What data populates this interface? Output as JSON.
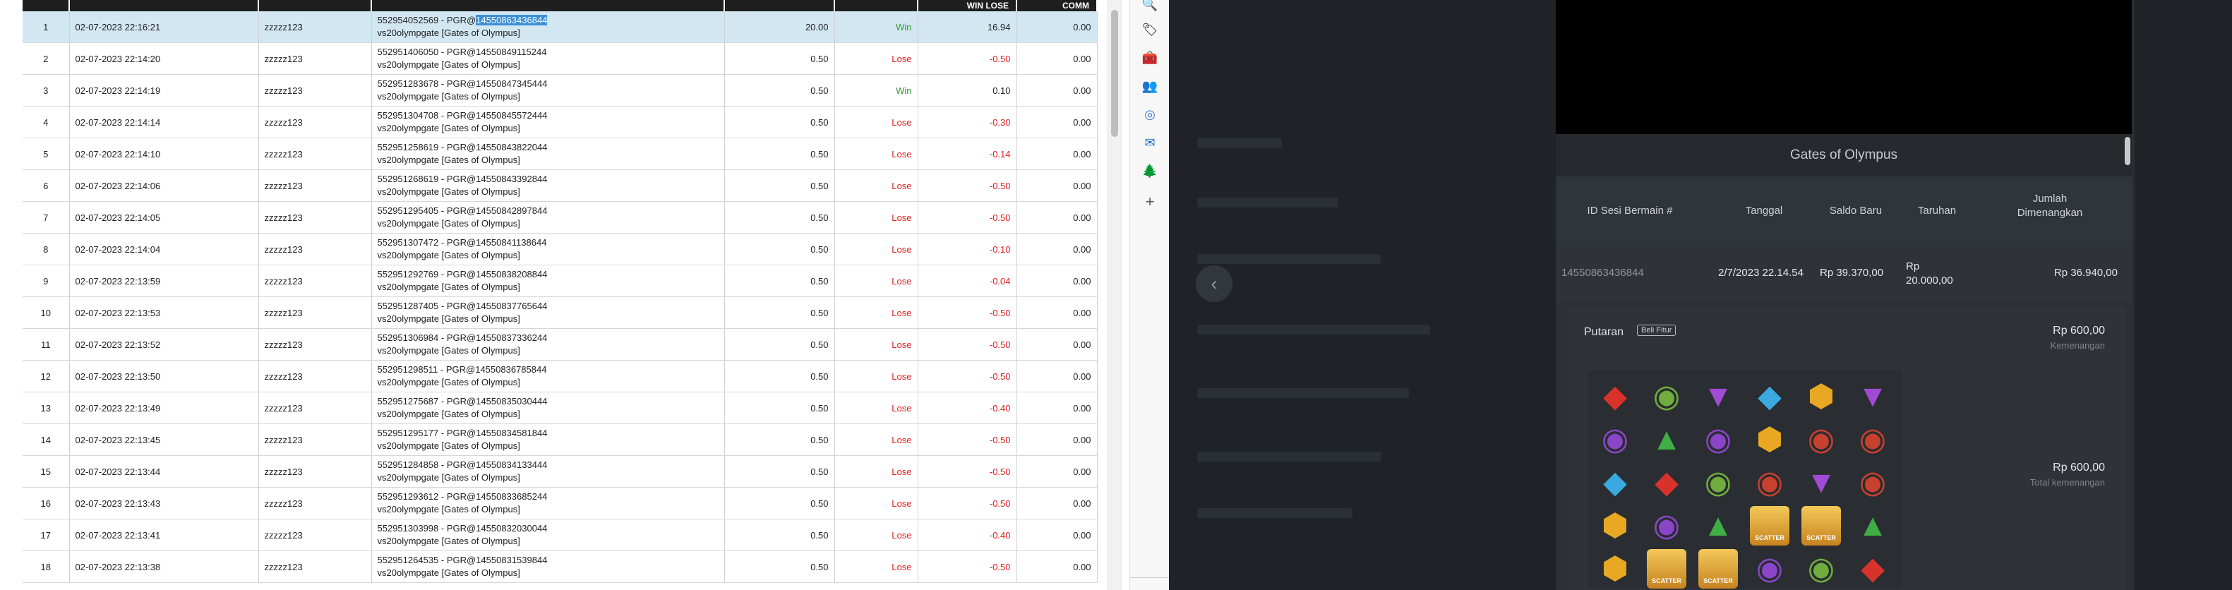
{
  "table": {
    "headers": [
      "",
      "",
      "",
      "",
      "",
      "",
      "WIN LOSE",
      "COMM"
    ],
    "rows": [
      {
        "no": "1",
        "date": "02-07-2023 22:16:21",
        "user": "zzzzz123",
        "round_prefix": "552954052569 - PGR@",
        "round_hl": "14550863436844",
        "game": "vs20olympgate [Gates of Olympus]",
        "bet": "20.00",
        "result": "Win",
        "winlose": "16.94",
        "comm": "0.00"
      },
      {
        "no": "2",
        "date": "02-07-2023 22:14:20",
        "user": "zzzzz123",
        "round_prefix": "552951406050 - PGR@14550849115244",
        "round_hl": "",
        "game": "vs20olympgate [Gates of Olympus]",
        "bet": "0.50",
        "result": "Lose",
        "winlose": "-0.50",
        "comm": "0.00"
      },
      {
        "no": "3",
        "date": "02-07-2023 22:14:19",
        "user": "zzzzz123",
        "round_prefix": "552951283678 - PGR@14550847345444",
        "round_hl": "",
        "game": "vs20olympgate [Gates of Olympus]",
        "bet": "0.50",
        "result": "Win",
        "winlose": "0.10",
        "comm": "0.00"
      },
      {
        "no": "4",
        "date": "02-07-2023 22:14:14",
        "user": "zzzzz123",
        "round_prefix": "552951304708 - PGR@14550845572444",
        "round_hl": "",
        "game": "vs20olympgate [Gates of Olympus]",
        "bet": "0.50",
        "result": "Lose",
        "winlose": "-0.30",
        "comm": "0.00"
      },
      {
        "no": "5",
        "date": "02-07-2023 22:14:10",
        "user": "zzzzz123",
        "round_prefix": "552951258619 - PGR@14550843822044",
        "round_hl": "",
        "game": "vs20olympgate [Gates of Olympus]",
        "bet": "0.50",
        "result": "Lose",
        "winlose": "-0.14",
        "comm": "0.00"
      },
      {
        "no": "6",
        "date": "02-07-2023 22:14:06",
        "user": "zzzzz123",
        "round_prefix": "552951268619 - PGR@14550843392844",
        "round_hl": "",
        "game": "vs20olympgate [Gates of Olympus]",
        "bet": "0.50",
        "result": "Lose",
        "winlose": "-0.50",
        "comm": "0.00"
      },
      {
        "no": "7",
        "date": "02-07-2023 22:14:05",
        "user": "zzzzz123",
        "round_prefix": "552951295405 - PGR@14550842897844",
        "round_hl": "",
        "game": "vs20olympgate [Gates of Olympus]",
        "bet": "0.50",
        "result": "Lose",
        "winlose": "-0.50",
        "comm": "0.00"
      },
      {
        "no": "8",
        "date": "02-07-2023 22:14:04",
        "user": "zzzzz123",
        "round_prefix": "552951307472 - PGR@14550841138644",
        "round_hl": "",
        "game": "vs20olympgate [Gates of Olympus]",
        "bet": "0.50",
        "result": "Lose",
        "winlose": "-0.10",
        "comm": "0.00"
      },
      {
        "no": "9",
        "date": "02-07-2023 22:13:59",
        "user": "zzzzz123",
        "round_prefix": "552951292769 - PGR@14550838208844",
        "round_hl": "",
        "game": "vs20olympgate [Gates of Olympus]",
        "bet": "0.50",
        "result": "Lose",
        "winlose": "-0.04",
        "comm": "0.00"
      },
      {
        "no": "10",
        "date": "02-07-2023 22:13:53",
        "user": "zzzzz123",
        "round_prefix": "552951287405 - PGR@14550837765644",
        "round_hl": "",
        "game": "vs20olympgate [Gates of Olympus]",
        "bet": "0.50",
        "result": "Lose",
        "winlose": "-0.50",
        "comm": "0.00"
      },
      {
        "no": "11",
        "date": "02-07-2023 22:13:52",
        "user": "zzzzz123",
        "round_prefix": "552951306984 - PGR@14550837336244",
        "round_hl": "",
        "game": "vs20olympgate [Gates of Olympus]",
        "bet": "0.50",
        "result": "Lose",
        "winlose": "-0.50",
        "comm": "0.00"
      },
      {
        "no": "12",
        "date": "02-07-2023 22:13:50",
        "user": "zzzzz123",
        "round_prefix": "552951298511 - PGR@14550836785844",
        "round_hl": "",
        "game": "vs20olympgate [Gates of Olympus]",
        "bet": "0.50",
        "result": "Lose",
        "winlose": "-0.50",
        "comm": "0.00"
      },
      {
        "no": "13",
        "date": "02-07-2023 22:13:49",
        "user": "zzzzz123",
        "round_prefix": "552951275687 - PGR@14550835030444",
        "round_hl": "",
        "game": "vs20olympgate [Gates of Olympus]",
        "bet": "0.50",
        "result": "Lose",
        "winlose": "-0.40",
        "comm": "0.00"
      },
      {
        "no": "14",
        "date": "02-07-2023 22:13:45",
        "user": "zzzzz123",
        "round_prefix": "552951295177 - PGR@14550834581844",
        "round_hl": "",
        "game": "vs20olympgate [Gates of Olympus]",
        "bet": "0.50",
        "result": "Lose",
        "winlose": "-0.50",
        "comm": "0.00"
      },
      {
        "no": "15",
        "date": "02-07-2023 22:13:44",
        "user": "zzzzz123",
        "round_prefix": "552951284858 - PGR@14550834133444",
        "round_hl": "",
        "game": "vs20olympgate [Gates of Olympus]",
        "bet": "0.50",
        "result": "Lose",
        "winlose": "-0.50",
        "comm": "0.00"
      },
      {
        "no": "16",
        "date": "02-07-2023 22:13:43",
        "user": "zzzzz123",
        "round_prefix": "552951293612 - PGR@14550833685244",
        "round_hl": "",
        "game": "vs20olympgate [Gates of Olympus]",
        "bet": "0.50",
        "result": "Lose",
        "winlose": "-0.50",
        "comm": "0.00"
      },
      {
        "no": "17",
        "date": "02-07-2023 22:13:41",
        "user": "zzzzz123",
        "round_prefix": "552951303998 - PGR@14550832030044",
        "round_hl": "",
        "game": "vs20olympgate [Gates of Olympus]",
        "bet": "0.50",
        "result": "Lose",
        "winlose": "-0.40",
        "comm": "0.00"
      },
      {
        "no": "18",
        "date": "02-07-2023 22:13:38",
        "user": "zzzzz123",
        "round_prefix": "552951264535 - PGR@14550831539844",
        "round_hl": "",
        "game": "vs20olympgate [Gates of Olympus]",
        "bet": "0.50",
        "result": "Lose",
        "winlose": "-0.50",
        "comm": "0.00"
      }
    ]
  },
  "sidebar": {
    "icons": [
      {
        "name": "search-icon",
        "glyph": "🔍"
      },
      {
        "name": "tag-icon",
        "glyph": "🏷"
      },
      {
        "name": "toolbox-icon",
        "glyph": "🧰"
      },
      {
        "name": "people-icon",
        "glyph": "👥"
      },
      {
        "name": "copilot-icon",
        "glyph": "◎"
      },
      {
        "name": "outlook-icon",
        "glyph": "✉"
      },
      {
        "name": "tree-icon",
        "glyph": "🌲"
      },
      {
        "name": "add-icon",
        "glyph": "+"
      }
    ]
  },
  "game": {
    "title": "Gates of Olympus",
    "back_icon": "‹",
    "columns": {
      "id": "ID Sesi Bermain #",
      "date": "Tanggal",
      "balance": "Saldo Baru",
      "bet": "Taruhan",
      "total": "Jumlah Dimenangkan"
    },
    "row": {
      "id": "14550863436844",
      "date": "2/7/2023 22.14.54",
      "balance": "Rp 39.370,00",
      "bet": "Rp 20.000,00",
      "total": "Rp 36.940,00"
    },
    "spin": {
      "label": "Putaran",
      "badge": "Beli Fitur",
      "win": "Rp 600,00",
      "win_label": "Kemenangan",
      "total": "Rp 600,00",
      "total_label": "Total kemenangan"
    },
    "scatter_label": "SCATTER",
    "grid": [
      [
        "red-gem",
        "green-ring",
        "purple-gem",
        "blue-gem",
        "gold-crown",
        "purple-gem"
      ],
      [
        "purple-ring",
        "green-gem",
        "purple-ring",
        "gold-crown",
        "red-ring",
        "red-ring"
      ],
      [
        "blue-gem",
        "red-gem",
        "green-ring",
        "red-ring",
        "purple-gem",
        "red-ring"
      ],
      [
        "gold-crown",
        "purple-ring",
        "green-gem",
        "scatter",
        "scatter",
        "green-gem"
      ],
      [
        "gold-crown",
        "scatter",
        "scatter",
        "purple-ring",
        "green-ring",
        "red-gem"
      ]
    ],
    "colors": {
      "bg": "#2a2e33",
      "panel": "#2c3035",
      "accent_red": "#e01e1e",
      "accent_green": "#2e9a2e"
    }
  }
}
